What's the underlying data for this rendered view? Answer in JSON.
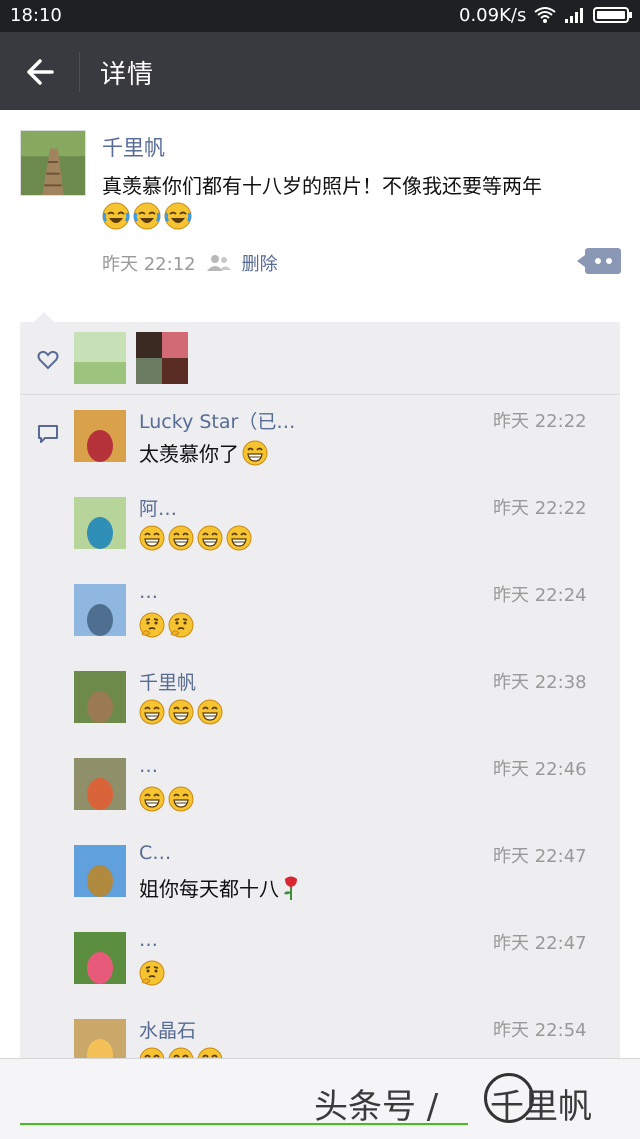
{
  "status_bar": {
    "time": "18:10",
    "net_speed": "0.09K/s"
  },
  "header": {
    "title": "详情"
  },
  "post": {
    "author": "千里帆",
    "text": "真羡慕你们都有十八岁的照片！不像我还要等两年",
    "emoji_count": 3,
    "time": "昨天 22:12",
    "delete_label": "删除"
  },
  "comments": [
    {
      "name": "Lucky Star（已…",
      "text": "太羡慕你了",
      "emoji_count": 1,
      "time": "昨天 22:22",
      "avatar_colors": [
        "#d9a14a",
        "#b5323a"
      ]
    },
    {
      "name": "阿…",
      "text": "",
      "emoji_count": 4,
      "time": "昨天 22:22",
      "avatar_colors": [
        "#b7d49a",
        "#2f8fb6"
      ]
    },
    {
      "name": "…",
      "text": "",
      "emoji_count": 2,
      "emoji": "thinking",
      "time": "昨天 22:24",
      "avatar_colors": [
        "#8fb7e0",
        "#4e6f8f"
      ]
    },
    {
      "name": "千里帆",
      "text": "",
      "emoji_count": 3,
      "time": "昨天 22:38",
      "avatar_colors": [
        "#6d8a4a",
        "#9a7a52"
      ]
    },
    {
      "name": "…",
      "text": "",
      "emoji_count": 2,
      "time": "昨天 22:46",
      "avatar_colors": [
        "#8f8f6a",
        "#d9643a"
      ]
    },
    {
      "name": "C…",
      "text": "姐你每天都十八",
      "emoji_count": 0,
      "rose": true,
      "time": "昨天 22:47",
      "avatar_colors": [
        "#5fa0dd",
        "#b08a3f"
      ]
    },
    {
      "name": "…",
      "text": "",
      "emoji_count": 1,
      "emoji": "thinking",
      "time": "昨天 22:47",
      "avatar_colors": [
        "#5b8f3f",
        "#e85a7a"
      ]
    },
    {
      "name": "水晶石",
      "text": "",
      "emoji_count": 3,
      "time": "昨天 22:54",
      "avatar_colors": [
        "#caa86a",
        "#f4c058"
      ]
    }
  ],
  "watermark": {
    "text": "头条号 / ",
    "brand": "千里帆"
  },
  "colors": {
    "link": "#576b95",
    "header_bg": "#393a3f",
    "status_bg": "#1f2024",
    "panel_bg": "#eeeef0"
  }
}
